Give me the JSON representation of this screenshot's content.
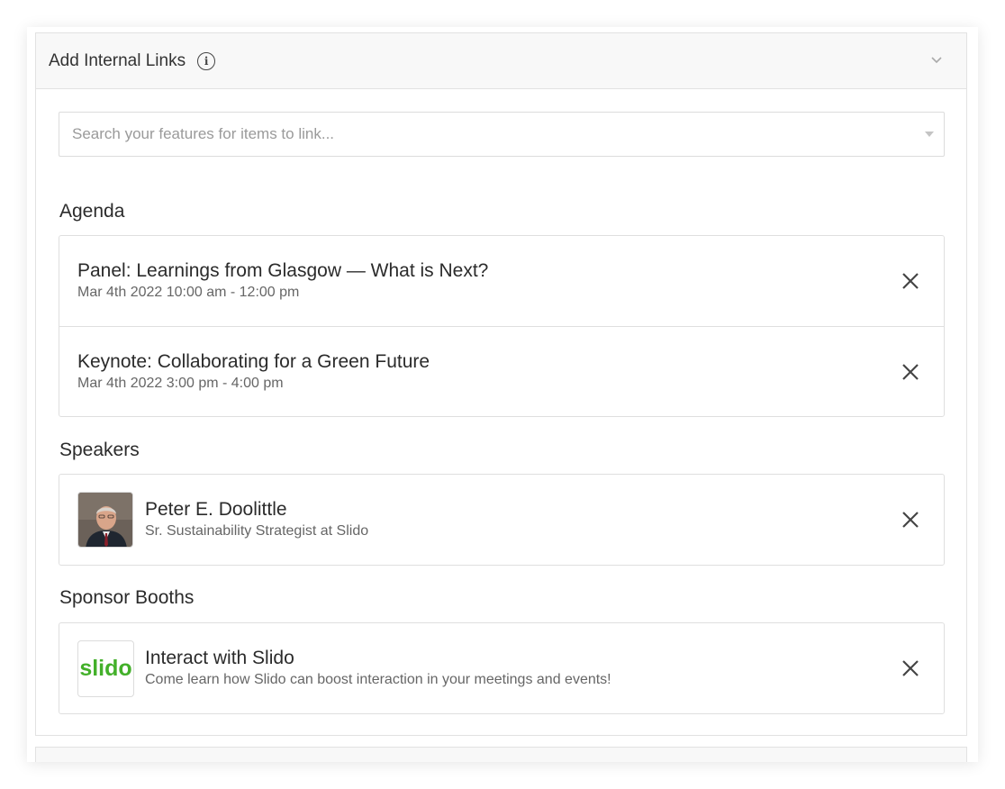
{
  "panel": {
    "title": "Add Internal Links"
  },
  "search": {
    "placeholder": "Search your features for items to link..."
  },
  "agenda": {
    "title": "Agenda",
    "items": [
      {
        "title": "Panel: Learnings from Glasgow — What is Next?",
        "time": "Mar 4th 2022 10:00 am - 12:00 pm"
      },
      {
        "title": "Keynote: Collaborating for a Green Future",
        "time": "Mar 4th 2022 3:00 pm - 4:00 pm"
      }
    ]
  },
  "speakers": {
    "title": "Speakers",
    "items": [
      {
        "name": "Peter E. Doolittle",
        "role": "Sr. Sustainability Strategist at Slido"
      }
    ]
  },
  "sponsors": {
    "title": "Sponsor Booths",
    "items": [
      {
        "logo_text": "slido",
        "name": "Interact with Slido",
        "description": "Come learn how Slido can boost interaction in your meetings and events!"
      }
    ]
  },
  "colors": {
    "slido_green": "#43b02a",
    "header_bg": "#f8f8f8",
    "border": "#e2e2e2"
  },
  "icons": {
    "info": "info-icon",
    "collapse": "chevron-down-icon",
    "remove": "close-icon",
    "dropdown": "caret-down-icon"
  }
}
